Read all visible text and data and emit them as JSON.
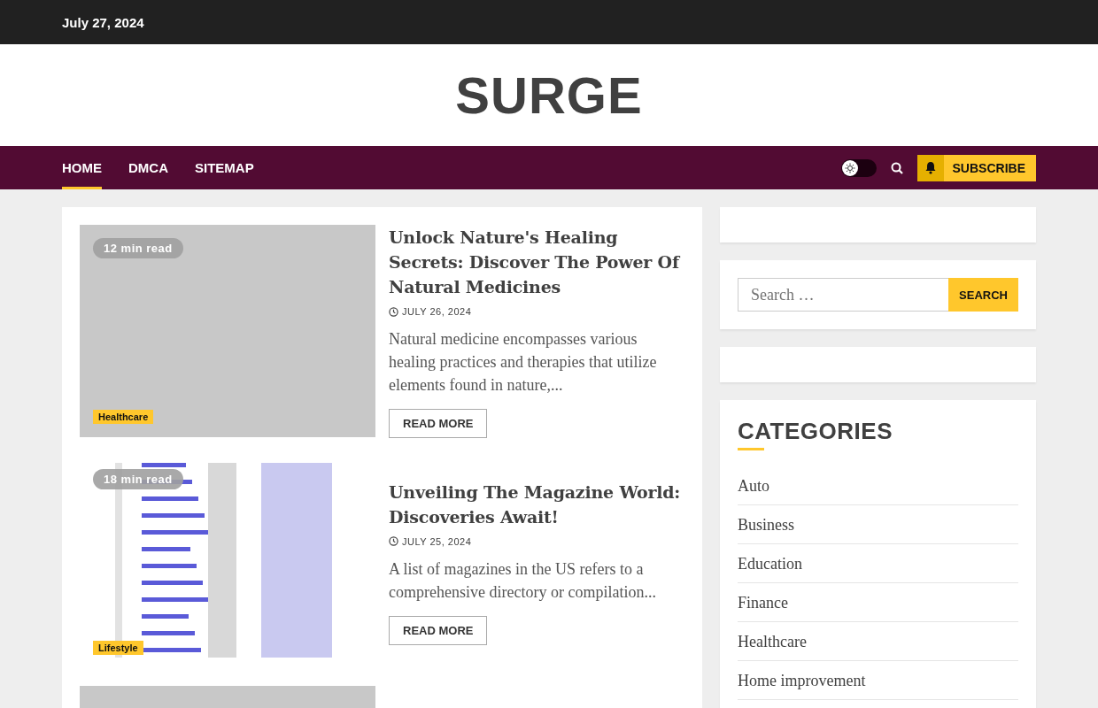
{
  "top_bar": {
    "date": "July 27, 2024"
  },
  "site": {
    "title": "SURGE"
  },
  "nav": {
    "items": [
      {
        "label": "HOME",
        "selected": true
      },
      {
        "label": "DMCA",
        "selected": false
      },
      {
        "label": "SITEMAP",
        "selected": false
      }
    ],
    "dark_mode": false,
    "subscribe": "SUBSCRIBE"
  },
  "articles": [
    {
      "kind": "blank",
      "read_time": "12 min read",
      "category": "Healthcare",
      "title": "Unlock Nature's Healing Secrets: Discover The Power Of Natural Medicines",
      "date": "JULY 26, 2024",
      "excerpt": "Natural medicine encompasses various healing practices and therapies that utilize elements found in nature,...",
      "button": "READ MORE"
    },
    {
      "kind": "picture",
      "read_time": "18 min read",
      "category": "Lifestyle",
      "title": "Unveiling The Magazine World: Discoveries Await!",
      "date": "JULY 25, 2024",
      "excerpt": "A list of magazines in the US refers to a comprehensive directory or compilation...",
      "button": "READ MORE"
    },
    {
      "kind": "blank"
    }
  ],
  "sidebar": {
    "search": {
      "placeholder": "Search …",
      "button": "SEARCH"
    },
    "categories": {
      "title": "CATEGORIES",
      "items": [
        "Auto",
        "Business",
        "Education",
        "Finance",
        "Healthcare",
        "Home improvement"
      ]
    }
  }
}
